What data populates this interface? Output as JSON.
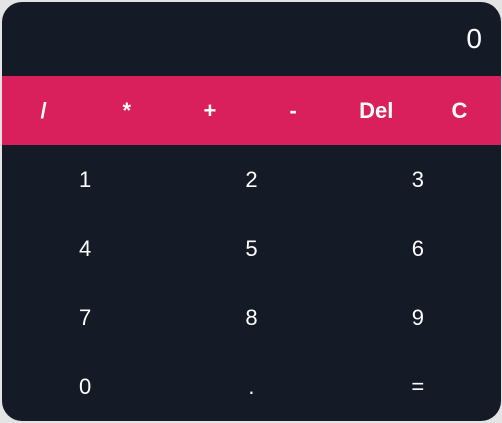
{
  "display": {
    "value": "0"
  },
  "operators": [
    "/",
    "*",
    "+",
    "-",
    "Del",
    "C"
  ],
  "digits": [
    "1",
    "2",
    "3",
    "4",
    "5",
    "6",
    "7",
    "8",
    "9",
    "0",
    ".",
    "="
  ],
  "colors": {
    "background": "#141a26",
    "accent": "#d9205c",
    "text": "#ffffff"
  }
}
